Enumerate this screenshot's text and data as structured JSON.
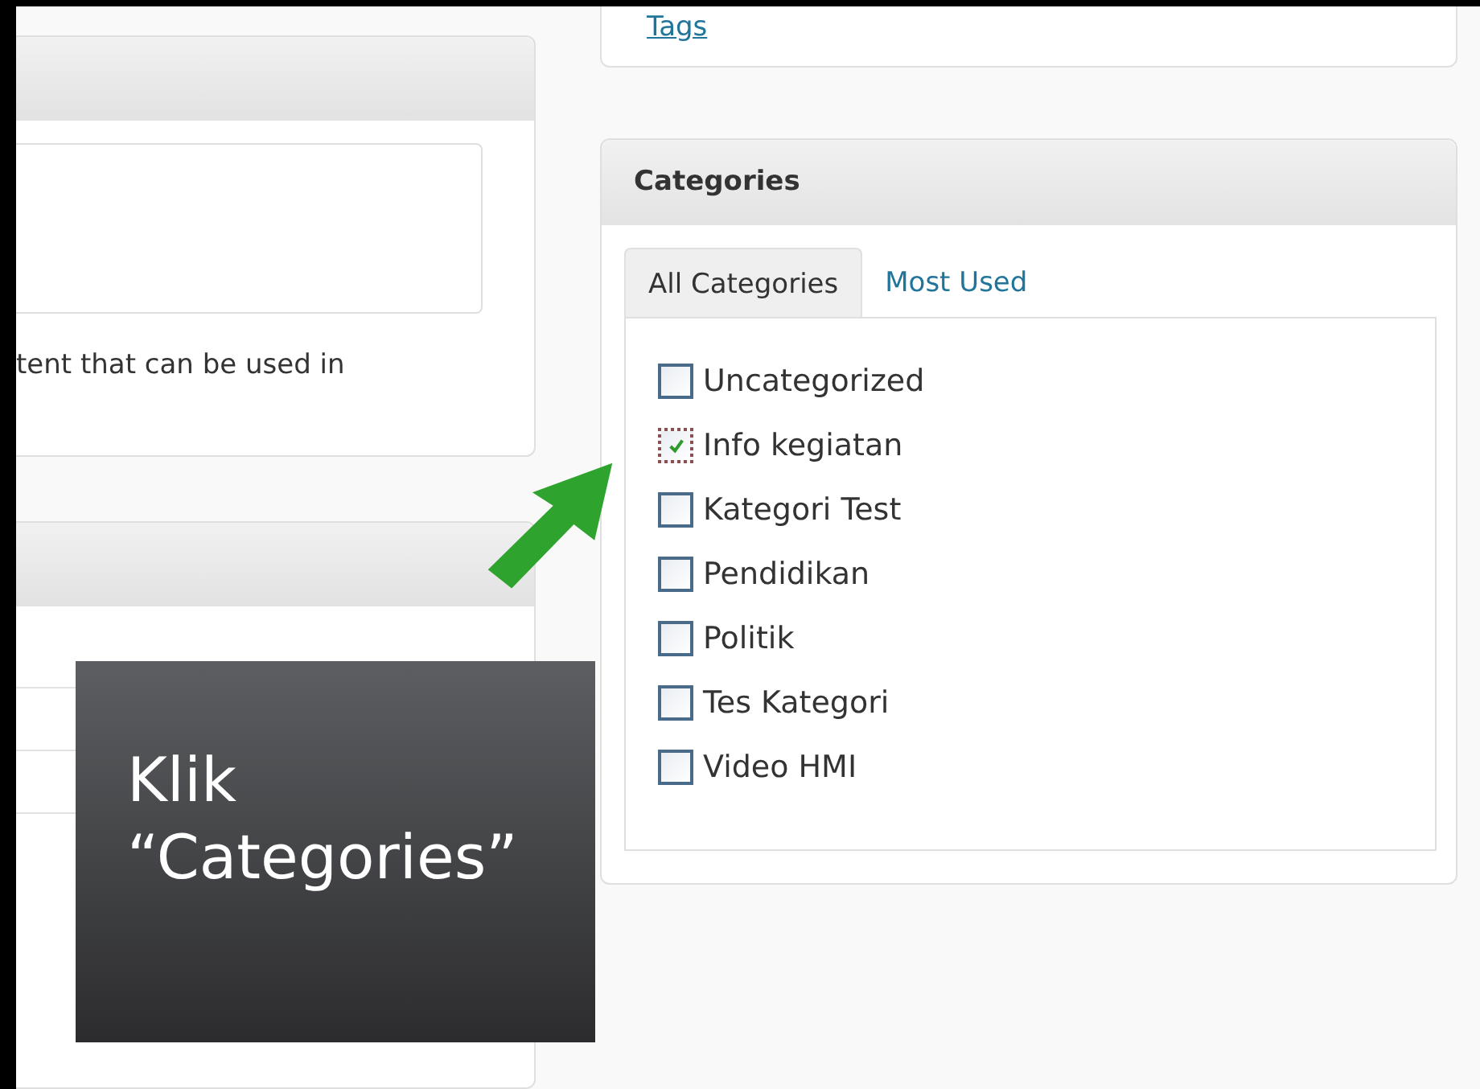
{
  "left_panel": {
    "body_text": "tent that can be used in"
  },
  "tags_panel": {
    "link": "Tags"
  },
  "categories_panel": {
    "title": "Categories",
    "tabs": [
      {
        "label": "All Categories",
        "selected": true
      },
      {
        "label": "Most Used",
        "selected": false
      }
    ],
    "items": [
      {
        "label": "Uncategorized",
        "checked": false
      },
      {
        "label": "Info kegiatan",
        "checked": true
      },
      {
        "label": "Kategori Test",
        "checked": false
      },
      {
        "label": "Pendidikan",
        "checked": false
      },
      {
        "label": "Politik",
        "checked": false
      },
      {
        "label": "Tes Kategori",
        "checked": false
      },
      {
        "label": "Video HMI",
        "checked": false
      }
    ]
  },
  "callout": {
    "lines": [
      "Klik",
      "“Categories”"
    ]
  }
}
